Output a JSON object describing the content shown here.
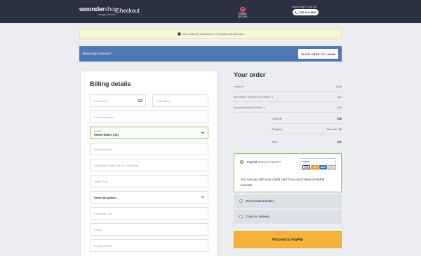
{
  "header": {
    "logo_main": "woonder",
    "logo_shop": "shop",
    "logo_sub": "storegsr delivers",
    "title": "Checkout",
    "secure_text": "McAfee SECURE",
    "help_text": "Need help? Call Us:",
    "phone": "333 123 4300"
  },
  "notice": {
    "reserve_text": "Your order is reserved for 19 minutes 23 seconds"
  },
  "returning": {
    "text": "Returning customer?",
    "button": "CLICK HERE TO LOGIN"
  },
  "billing": {
    "title": "Billing details",
    "first_name": "First name",
    "last_name": "Last name",
    "company": "Company name",
    "country_label": "Country",
    "country_value": "United States (US)",
    "street": "Street address",
    "apartment": "Apartment, suite, unit etc. (optional)",
    "city": "Town / City",
    "state": "Select an option…",
    "postcode": "Postcode / ZIP",
    "phone": "Phone",
    "email": "Email address"
  },
  "order": {
    "title": "Your order",
    "col_product": "Product",
    "col_total": "Total",
    "items": [
      {
        "name": "Red Mother Trhemites for Plants × 1",
        "total": "$17"
      },
      {
        "name": "Decorative Artificial Plant × 1",
        "total": "$19"
      }
    ],
    "subtotal_label": "Subtotal",
    "subtotal": "$36",
    "shipping_label": "Shipping",
    "shipping": "Flat rate: $5",
    "total_label": "Total",
    "total": "$41"
  },
  "payment": {
    "paypal_label": "PayPal",
    "paypal_link": "What is PayPal?",
    "paypal_brand": "PayPal",
    "cards": [
      "VISA",
      "MC",
      "AMEX",
      "DISC"
    ],
    "paypal_desc": "You can pay with your credit card if you don't have a PayPal account.",
    "bank": "Direct bank transfer",
    "cod": "Cash on delivery",
    "proceed": "Proceed to PayPal"
  },
  "colors": {
    "header_bg": "#2b3140",
    "returning_bg": "#4f78b6",
    "accent_green": "#8fc26f",
    "proceed_bg": "#f6b33c"
  }
}
